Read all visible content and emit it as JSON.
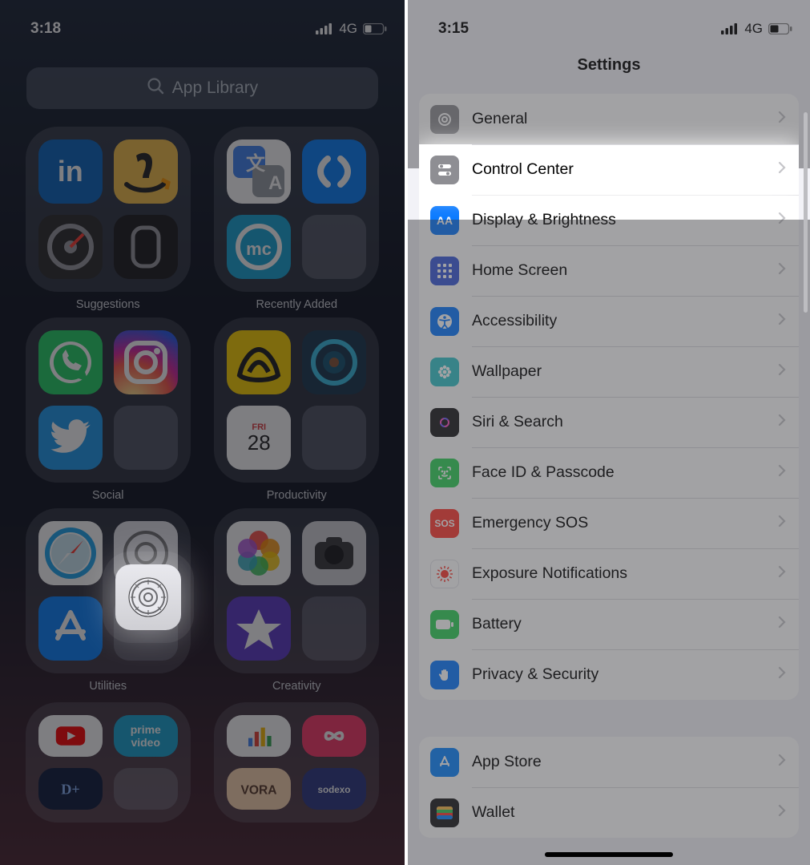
{
  "left": {
    "status": {
      "time": "3:18",
      "network": "4G"
    },
    "search": {
      "placeholder": "App Library"
    },
    "folders": [
      {
        "label": "Suggestions",
        "apps": [
          {
            "name": "LinkedIn",
            "bg": "#0a66c2",
            "glyph": "in"
          },
          {
            "name": "Amazon",
            "bg": "#f7c14b",
            "glyph": "amazon"
          },
          {
            "name": "Measure",
            "bg": "#2a2a2a",
            "glyph": "dial"
          },
          {
            "name": "Watch",
            "bg": "#1b1b1d",
            "glyph": "watch"
          }
        ]
      },
      {
        "label": "Recently Added",
        "apps": [
          {
            "name": "Google Translate",
            "bg": "#ffffff",
            "glyph": "gtranslate"
          },
          {
            "name": "Shazam",
            "bg": "#0a84ff",
            "glyph": "shazam"
          },
          {
            "name": "MobileCare",
            "bg": "#17a7d8",
            "glyph": "mc"
          },
          {
            "name": "More",
            "bg": "mini",
            "mini": [
              "#1c1c1e",
              "#34c759",
              "#ff7a1a",
              "#1fa0e8"
            ]
          }
        ]
      },
      {
        "label": "Social",
        "apps": [
          {
            "name": "WhatsApp",
            "bg": "#25d366",
            "glyph": "whatsapp"
          },
          {
            "name": "Instagram",
            "bg": "insta",
            "glyph": "instagram"
          },
          {
            "name": "Twitter",
            "bg": "#1d9bf0",
            "glyph": "twitter"
          },
          {
            "name": "More",
            "bg": "mini",
            "mini": [
              "#1877f2",
              "#0a66c2",
              "#fffc00",
              "#29a9ea"
            ]
          }
        ]
      },
      {
        "label": "Productivity",
        "apps": [
          {
            "name": "Basecamp",
            "bg": "#ffd400",
            "glyph": "basecamp"
          },
          {
            "name": "Camera-like",
            "bg": "#1c3b52",
            "glyph": "lens"
          },
          {
            "name": "Calendar",
            "bg": "#ffffff",
            "glyph": "calendar",
            "day": "FRI",
            "num": "28"
          },
          {
            "name": "More",
            "bg": "mini",
            "mini": [
              "#f7b84a",
              "#0f6cbf",
              "#85d02a",
              "#0a84ff"
            ]
          }
        ]
      },
      {
        "label": "Utilities",
        "apps": [
          {
            "name": "Safari",
            "bg": "#ffffff",
            "glyph": "safari"
          },
          {
            "name": "Settings",
            "bg": "#e5e5ea",
            "glyph": "gear"
          },
          {
            "name": "App Store",
            "bg": "#0a84ff",
            "glyph": "appstore"
          },
          {
            "name": "More",
            "bg": "mini",
            "mini": [
              "#3a3a3c",
              "#ffffff",
              "#1c1c1e",
              "#ff9500"
            ]
          }
        ]
      },
      {
        "label": "Creativity",
        "apps": [
          {
            "name": "Photos",
            "bg": "#ffffff",
            "glyph": "photos"
          },
          {
            "name": "Camera",
            "bg": "#d9d9de",
            "glyph": "camera"
          },
          {
            "name": "iMovie",
            "bg": "#5e3bc9",
            "glyph": "star"
          },
          {
            "name": "More",
            "bg": "mini",
            "mini": [
              "#ff3b30",
              "#1c1c1e",
              "#ff2d55",
              "#ff9500"
            ]
          }
        ]
      }
    ],
    "bottom": [
      {
        "apps": [
          {
            "name": "YouTube",
            "bg": "#ffffff",
            "glyph": "youtube"
          },
          {
            "name": "Prime Video",
            "bg": "#1aa7d4",
            "glyph": "prime",
            "text1": "prime",
            "text2": "video"
          },
          {
            "name": "Disney+",
            "bg": "#0f1b3d",
            "glyph": "disney"
          },
          {
            "name": "More",
            "bg": "mini",
            "mini": [
              "#00a651",
              "#e50914",
              "#0a84ff",
              "#7a7a7a"
            ]
          }
        ]
      },
      {
        "apps": [
          {
            "name": "App A",
            "bg": "#ffffff",
            "glyph": "bars"
          },
          {
            "name": "App B",
            "bg": "#ff3b6b",
            "glyph": "infinity"
          },
          {
            "name": "App C",
            "bg": "#ffd9b3",
            "glyph": "vora"
          },
          {
            "name": "App D",
            "bg": "#2f3a88",
            "glyph": "sodexo"
          }
        ]
      }
    ]
  },
  "right": {
    "status": {
      "time": "3:15",
      "network": "4G"
    },
    "title": "Settings",
    "group1": [
      {
        "id": "general",
        "label": "General",
        "icon": "gear",
        "bg": "#8e8e93"
      },
      {
        "id": "control-center",
        "label": "Control Center",
        "icon": "toggles",
        "bg": "#8e8e93",
        "highlighted": true
      },
      {
        "id": "display-brightness",
        "label": "Display & Brightness",
        "icon": "AA",
        "bg": "#0a7aff"
      },
      {
        "id": "home-screen",
        "label": "Home Screen",
        "icon": "grid",
        "bg": "#3a5bd9"
      },
      {
        "id": "accessibility",
        "label": "Accessibility",
        "icon": "accessibility",
        "bg": "#0a7aff"
      },
      {
        "id": "wallpaper",
        "label": "Wallpaper",
        "icon": "flower",
        "bg": "#35c4c9"
      },
      {
        "id": "siri-search",
        "label": "Siri & Search",
        "icon": "siri",
        "bg": "#1c1c1e"
      },
      {
        "id": "faceid-passcode",
        "label": "Face ID & Passcode",
        "icon": "faceid",
        "bg": "#30d158"
      },
      {
        "id": "emergency-sos",
        "label": "Emergency SOS",
        "icon": "SOS",
        "bg": "#ff3b30"
      },
      {
        "id": "exposure-notifications",
        "label": "Exposure Notifications",
        "icon": "exposure",
        "bg": "#ffffff"
      },
      {
        "id": "battery",
        "label": "Battery",
        "icon": "battery",
        "bg": "#30d158"
      },
      {
        "id": "privacy-security",
        "label": "Privacy & Security",
        "icon": "hand",
        "bg": "#0a7aff"
      }
    ],
    "group2": [
      {
        "id": "app-store",
        "label": "App Store",
        "icon": "appstore",
        "bg": "#0a84ff"
      },
      {
        "id": "wallet",
        "label": "Wallet",
        "icon": "wallet",
        "bg": "#1c1c1e"
      }
    ]
  }
}
